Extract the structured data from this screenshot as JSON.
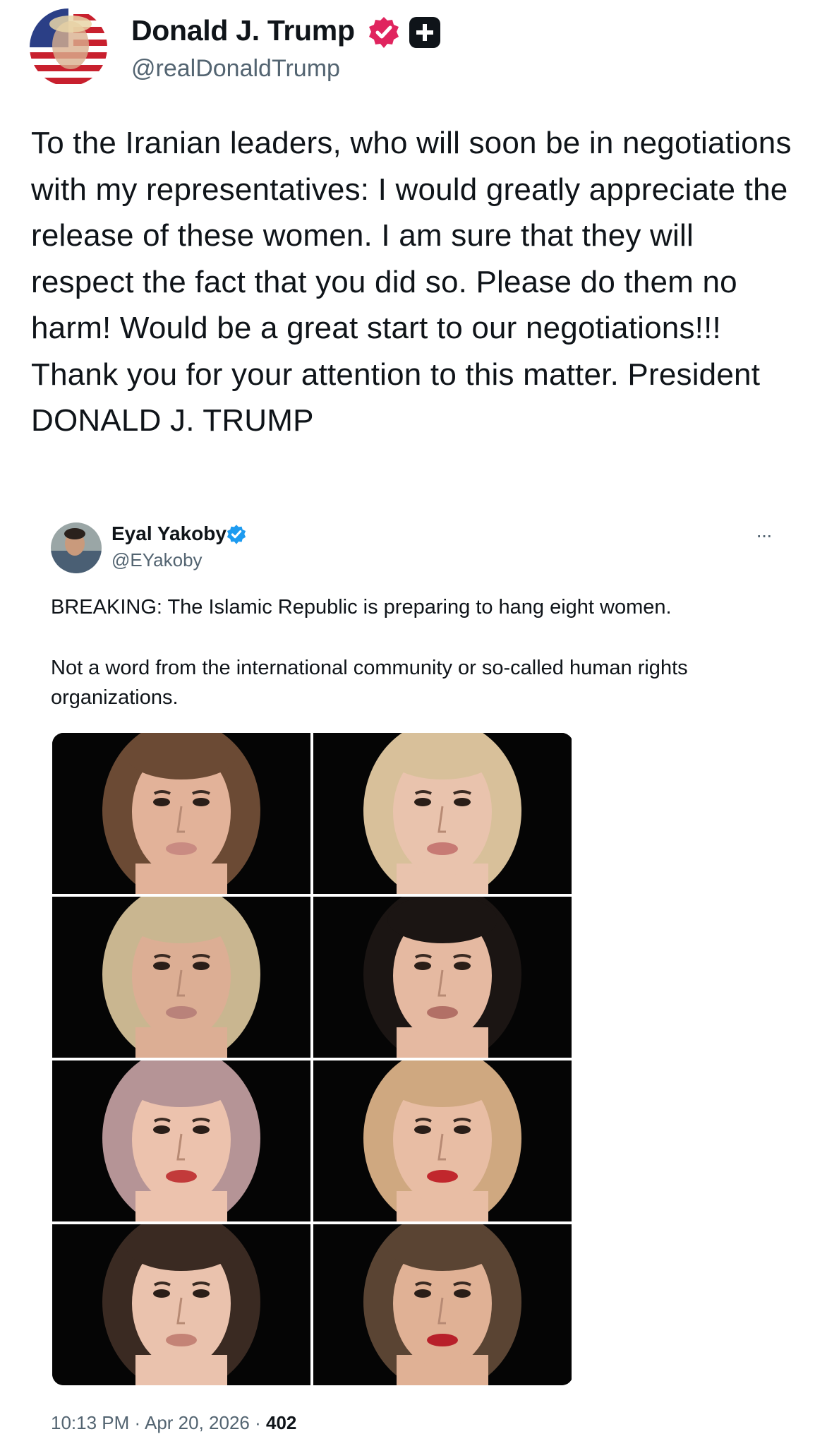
{
  "post": {
    "author": {
      "display_name": "Donald J. Trump",
      "handle": "@realDonaldTrump",
      "verified_icon": "verified-badge-icon",
      "extra_icon": "plus-badge-icon",
      "verified_color": "#e0245e"
    },
    "text": "To the Iranian leaders, who will soon be in negotiations with my representatives: I would greatly appreciate the release of these women. I am sure that they will respect the fact that you did so. Please do them no harm! Would be a great start to our negotiations!!! Thank you for your attention to this matter. President DONALD J. TRUMP"
  },
  "quote": {
    "author": {
      "display_name": "Eyal Yakoby",
      "handle": "@EYakoby",
      "verified_color": "#1d9bf0"
    },
    "more_icon": "more-horizontal-icon",
    "more_label": "···",
    "lines": [
      "BREAKING: The Islamic Republic is preparing to hang eight women.",
      "Not a word from the international community or so-called human rights",
      "organizations."
    ],
    "photos": [
      {
        "hair": "#6b4a34",
        "skin": "#e2b299",
        "lips": "#c98b82"
      },
      {
        "hair": "#d8c09a",
        "skin": "#e9c3ad",
        "lips": "#c77a74"
      },
      {
        "hair": "#c9b690",
        "skin": "#dcae94",
        "lips": "#b9827a"
      },
      {
        "hair": "#1b1513",
        "skin": "#e5b9a1",
        "lips": "#b27066"
      },
      {
        "hair": "#b59496",
        "skin": "#ecc2ad",
        "lips": "#c23a3a"
      },
      {
        "hair": "#cfa880",
        "skin": "#e8bda4",
        "lips": "#c1272d"
      },
      {
        "hair": "#3a2a22",
        "skin": "#eac2ad",
        "lips": "#c48376"
      },
      {
        "hair": "#5a4433",
        "skin": "#e0b195",
        "lips": "#b8202a"
      }
    ],
    "footer": {
      "time": "10:13 PM",
      "date": "Apr 20, 2026",
      "views": "402"
    }
  }
}
